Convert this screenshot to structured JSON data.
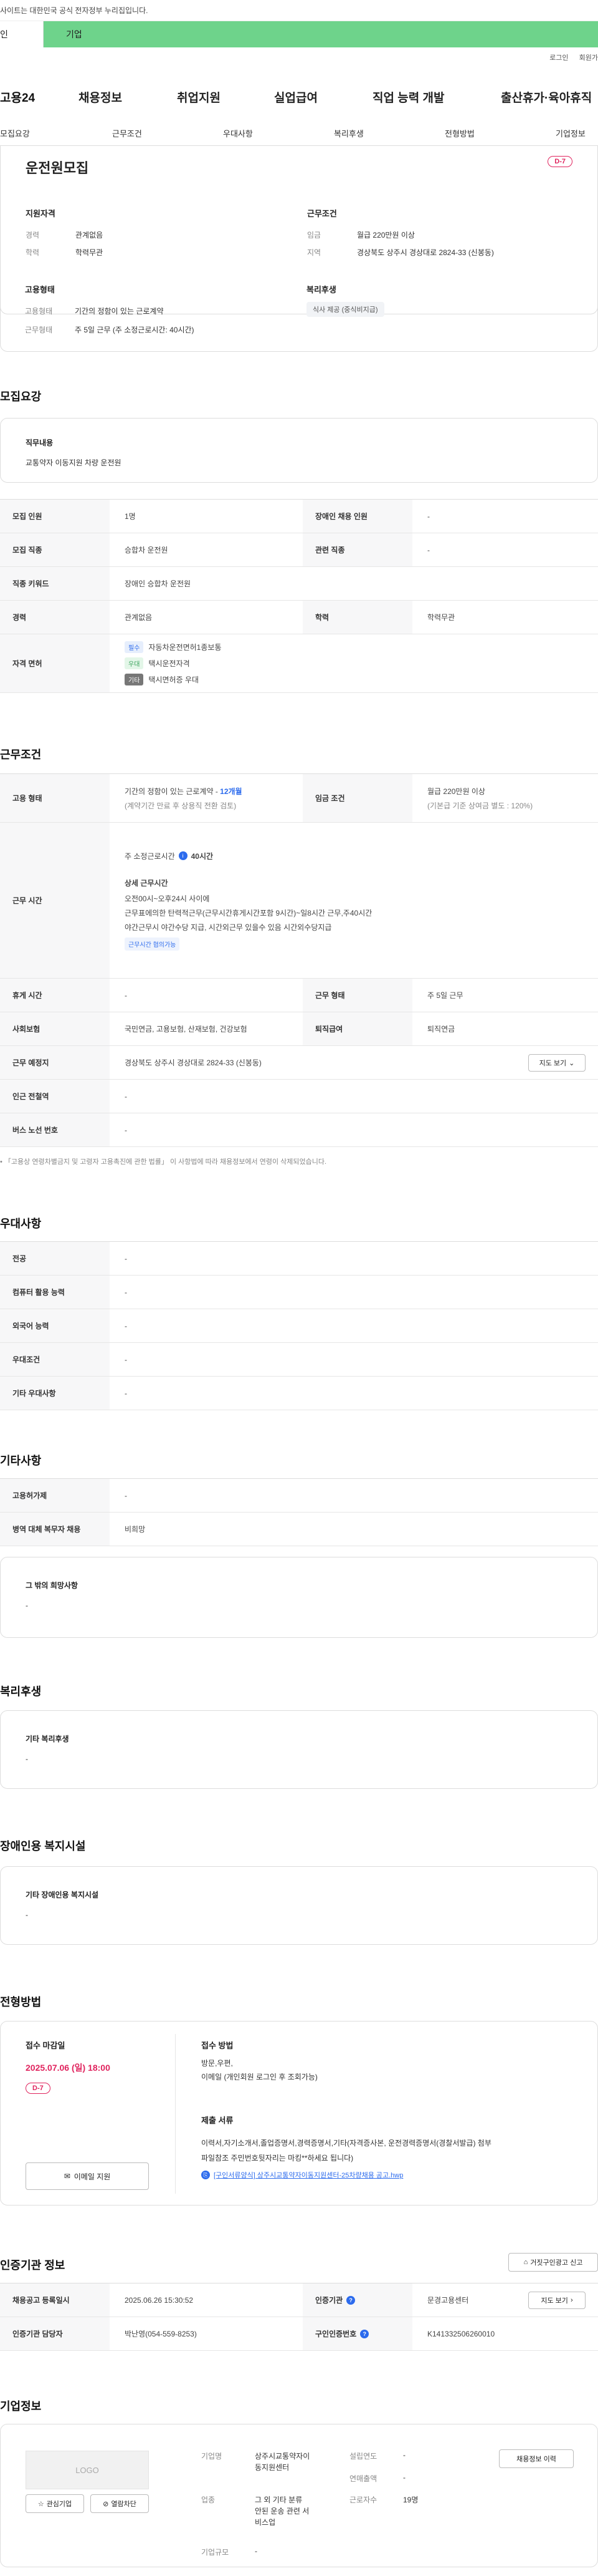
{
  "header": {
    "notice": "사이트는 대한민국 공식 전자정부 누리집입니다.",
    "tab_person": "인",
    "tab_company": "기업",
    "util": [
      "로그인",
      "회원가"
    ],
    "logo": "고용24",
    "menu": [
      "채용정보",
      "취업지원",
      "실업급여",
      "직업 능력 개발",
      "출산휴가·육아휴직"
    ]
  },
  "subnav": [
    "모집요강",
    "근무조건",
    "우대사항",
    "복리후생",
    "전형방법",
    "기업정보"
  ],
  "summary": {
    "title": "운전원모집",
    "dday": "D-7",
    "qual_heading": "지원자격",
    "career_label": "경력",
    "career": "관계없음",
    "edu_label": "학력",
    "edu": "학력무관",
    "cond_heading": "근무조건",
    "wage_label": "임금",
    "wage": "월급 220만원 이상",
    "region_label": "지역",
    "region": "경상북도 상주시 경상대로 2824-33 (신봉동)",
    "emp_heading": "고용형태",
    "emptype_label": "고용형태",
    "emptype": "기간의 정함이 있는 근로계약",
    "worktype_label": "근무형태",
    "worktype": "주 5일 근무 (주 소정근로시간: 40시간)",
    "welfare_heading": "복리후생",
    "welfare_chip": "식사 제공 (중식비지급)"
  },
  "recruit": {
    "heading": "모집요강",
    "duty_label": "직무내용",
    "duty": "교통약자 이동지원 차량 운전원",
    "rows": [
      {
        "a_label": "모집 인원",
        "a": "1명",
        "b_label": "장애인 채용 인원",
        "b": "-"
      },
      {
        "a_label": "모집 직종",
        "a": "승합차 운전원",
        "b_label": "관련 직종",
        "b": "-"
      },
      {
        "a_label": "직종 키워드",
        "a": "장애인 승합차 운전원"
      },
      {
        "a_label": "경력",
        "a": "관계없음",
        "b_label": "학력",
        "b": "학력무관"
      }
    ],
    "license_label": "자격 면허",
    "licenses": [
      {
        "badge": "필수",
        "text": "자동차운전면허1종보통"
      },
      {
        "badge": "우대",
        "text": "택시운전자격"
      },
      {
        "badge": "기타",
        "text": "택시면허증 우대"
      }
    ]
  },
  "work": {
    "heading": "근무조건",
    "emp_label": "고용 형태",
    "emp_line1_pre": "기간의 정함이 있는 근로계약 - ",
    "emp_line1_em": "12개월",
    "emp_line2": "(계약기간 만료 후 상용직 전환 검토)",
    "wage_label": "임금 조건",
    "wage_line1": "월급 220만원 이상",
    "wage_line2": "(기본급 기준 상여금 별도 : 120%)",
    "time_label": "근무 시간",
    "time_title": "주 소정근로시간",
    "time_hours": "40시간",
    "detail_title": "상세 근무시간",
    "detail_lines": [
      "오전00시~오후24시 사이에",
      "근무표에의한  탄력적근무(근무시간휴게시간포함  9시간)~일8시간 근무,주40시간",
      "야간근무시 야간수당 지급, 시간외근무 있을수 있음 시간외수당지급"
    ],
    "time_chip": "근무시간 협의가능",
    "rest_label": "휴게 시간",
    "rest": "-",
    "form_label": "근무 형태",
    "form": "주 5일 근무",
    "ins_label": "사회보험",
    "ins": "국민연금, 고용보험, 산재보험, 건강보험",
    "ret_label": "퇴직급여",
    "ret": "퇴직연금",
    "place_label": "근무 예정지",
    "place": "경상북도 상주시 경상대로 2824-33 (신봉동)",
    "map_btn": "지도 보기",
    "subway_label": "인근 전철역",
    "subway": "-",
    "bus_label": "버스 노선 번호",
    "bus": "-",
    "note": "「고용상 연령차별금지 및 고령자 고용촉진에 관한 법률」 이 사항법에 따라 채용정보에서 연령이 삭제되었습니다."
  },
  "pref": {
    "heading": "우대사항",
    "rows": [
      {
        "label": "전공",
        "val": "-"
      },
      {
        "label": "컴퓨터 활용 능력",
        "val": "-"
      },
      {
        "label": "외국어 능력",
        "val": "-"
      },
      {
        "label": "우대조건",
        "val": "-"
      },
      {
        "label": "기타 우대사항",
        "val": "-"
      }
    ]
  },
  "etc": {
    "heading": "기타사항",
    "rows": [
      {
        "label": "고용허가제",
        "val": "-"
      },
      {
        "label": "병역 대체 복무자 채용",
        "val": "비희망"
      }
    ],
    "wish_label": "그 밖의 희망사항",
    "wish": "-"
  },
  "welfare": {
    "heading": "복리후생",
    "label": "기타 복리후생",
    "val": "-"
  },
  "disab": {
    "heading": "장애인용 복지시설",
    "label": "기타 장애인용 복지시설",
    "val": "-"
  },
  "process": {
    "heading": "전형방법",
    "deadline_label": "접수 마감일",
    "deadline": "2025.07.06 (일) 18:00",
    "dday": "D-7",
    "email_btn": "이메일 지원",
    "method_label": "접수 방법",
    "method_lines": [
      "방문,우편,",
      "이메일 (개인회원 로그인 후 조회가능)"
    ],
    "docs_label": "제출 서류",
    "docs_lines": [
      "이력서,자기소개서,졸업증명서,경력증명서,기타(자격증사본, 운전경력증명서(경찰서발급) 첨부",
      "파일참조 주민번호뒷자리는 마킹**하세요 됩니다)"
    ],
    "file": "[구인서류양식] 상주시교통약자이동지원센터-25차량채용 공고.hwp"
  },
  "agency": {
    "heading": "인증기관 정보",
    "report_btn": "거짓구인광고 신고",
    "reg_label": "채용공고 등록일시",
    "reg": "2025.06.26 15:30:52",
    "org_label": "인증기관",
    "org": "문경고용센터",
    "map_btn": "지도 보기",
    "mgr_label": "인증기관 담당자",
    "mgr": "박난영(054-559-8253)",
    "num_label": "구인인증번호",
    "num": "K141332506260010"
  },
  "company": {
    "heading": "기업정보",
    "logo": "LOGO",
    "fav_btn": "관심기업",
    "open_btn": "열람차단",
    "name_label": "기업명",
    "name_lines": [
      "상주시교통약자이",
      "동지원센터"
    ],
    "ind_label": "업종",
    "ind_lines": [
      "그 외 기타 분류",
      "안된 운송 관련 서",
      "비스업"
    ],
    "size_label": "기업규모",
    "size": "-",
    "year_label": "설립연도",
    "year": "-",
    "sales_label": "연매출액",
    "sales": "-",
    "emp_label": "근로자수",
    "emp": "19명",
    "jobs_btn": "채용정보 이력"
  }
}
